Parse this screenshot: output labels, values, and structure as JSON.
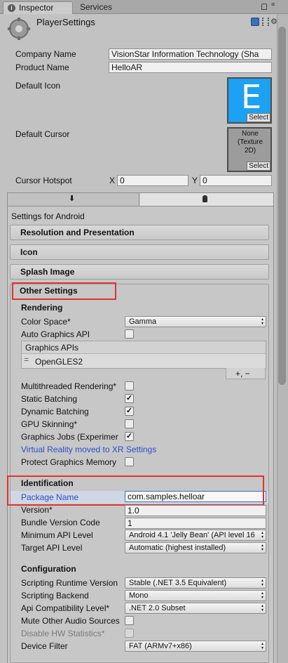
{
  "tabs": {
    "inspector": "Inspector",
    "services": "Services"
  },
  "header": {
    "title": "PlayerSettings"
  },
  "fields": {
    "company_name_label": "Company Name",
    "company_name_value": "VisionStar Information Technology (Sha",
    "product_name_label": "Product Name",
    "product_name_value": "HelloAR",
    "default_icon_label": "Default Icon",
    "default_icon_letter": "E",
    "select_label": "Select",
    "default_cursor_label": "Default Cursor",
    "cursor_none_text": "None (Texture 2D)",
    "cursor_hotspot_label": "Cursor Hotspot",
    "hotspot_x_label": "X",
    "hotspot_x_value": "0",
    "hotspot_y_label": "Y",
    "hotspot_y_value": "0"
  },
  "platform": {
    "settings_for": "Settings for Android"
  },
  "sections": {
    "resolution": "Resolution and Presentation",
    "icon": "Icon",
    "splash": "Splash Image",
    "other": "Other Settings"
  },
  "rendering": {
    "title": "Rendering",
    "color_space_label": "Color Space*",
    "color_space_value": "Gamma",
    "auto_graphics_label": "Auto Graphics API",
    "graphics_apis_header": "Graphics APIs",
    "graphics_api_item": "OpenGLES2",
    "add_remove": "+,  −",
    "multithreaded_label": "Multithreaded Rendering*",
    "static_batching_label": "Static Batching",
    "dynamic_batching_label": "Dynamic Batching",
    "gpu_skinning_label": "GPU Skinning*",
    "graphics_jobs_label": "Graphics Jobs (Experimer",
    "vr_link": "Virtual Reality moved to XR Settings",
    "protect_memory_label": "Protect Graphics Memory"
  },
  "checks": {
    "auto_graphics": false,
    "multithreaded": false,
    "static_batching": true,
    "dynamic_batching": true,
    "gpu_skinning": false,
    "graphics_jobs": true,
    "protect_memory": false,
    "mute_audio": false,
    "disable_hw_stats": false
  },
  "identification": {
    "title": "Identification",
    "package_name_label": "Package Name",
    "package_name_value": "com.samples.helloar",
    "version_label": "Version*",
    "version_value": "1.0",
    "bundle_code_label": "Bundle Version Code",
    "bundle_code_value": "1",
    "min_api_label": "Minimum API Level",
    "min_api_value": "Android 4.1 'Jelly Bean' (API level 16",
    "target_api_label": "Target API Level",
    "target_api_value": "Automatic (highest installed)"
  },
  "configuration": {
    "title": "Configuration",
    "runtime_label": "Scripting Runtime Version",
    "runtime_value": "Stable (.NET 3.5 Equivalent)",
    "backend_label": "Scripting Backend",
    "backend_value": "Mono",
    "api_compat_label": "Api Compatibility Level*",
    "api_compat_value": ".NET 2.0 Subset",
    "mute_audio_label": "Mute Other Audio Sources",
    "disable_hw_label": "Disable HW Statistics*",
    "device_filter_label": "Device Filter",
    "device_filter_value": "FAT (ARMv7+x86)"
  },
  "colors": {
    "highlight": "#e0332f",
    "link": "#2950c6",
    "icon_bg": "#1da1f2"
  }
}
